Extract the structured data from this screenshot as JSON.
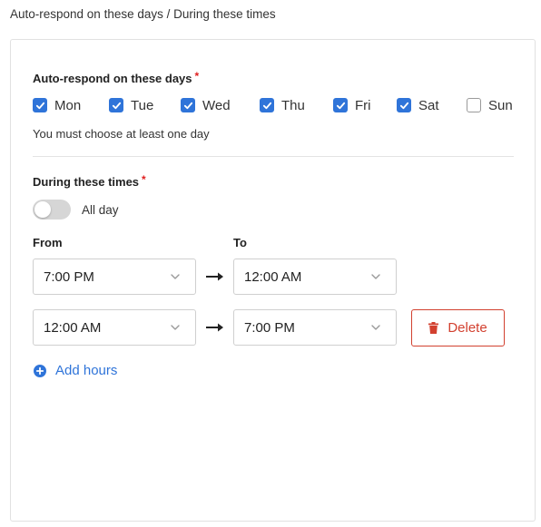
{
  "page": {
    "heading": "Auto-respond on these days / During these times"
  },
  "days_section": {
    "label": "Auto-respond on these days",
    "required_mark": "*",
    "days": [
      {
        "label": "Mon",
        "checked": true
      },
      {
        "label": "Tue",
        "checked": true
      },
      {
        "label": "Wed",
        "checked": true
      },
      {
        "label": "Thu",
        "checked": true
      },
      {
        "label": "Fri",
        "checked": true
      },
      {
        "label": "Sat",
        "checked": true
      },
      {
        "label": "Sun",
        "checked": false
      }
    ],
    "helper_text": "You must choose at least one day"
  },
  "times_section": {
    "label": "During these times",
    "required_mark": "*",
    "all_day_label": "All day",
    "all_day_on": false,
    "from_label": "From",
    "to_label": "To",
    "ranges": [
      {
        "from": "7:00 PM",
        "to": "12:00 AM"
      },
      {
        "from": "12:00 AM",
        "to": "7:00 PM"
      }
    ],
    "delete_label": "Delete",
    "add_hours_label": "Add hours"
  },
  "colors": {
    "accent": "#2f74d9",
    "danger": "#d2402f",
    "required": "#e02020"
  }
}
